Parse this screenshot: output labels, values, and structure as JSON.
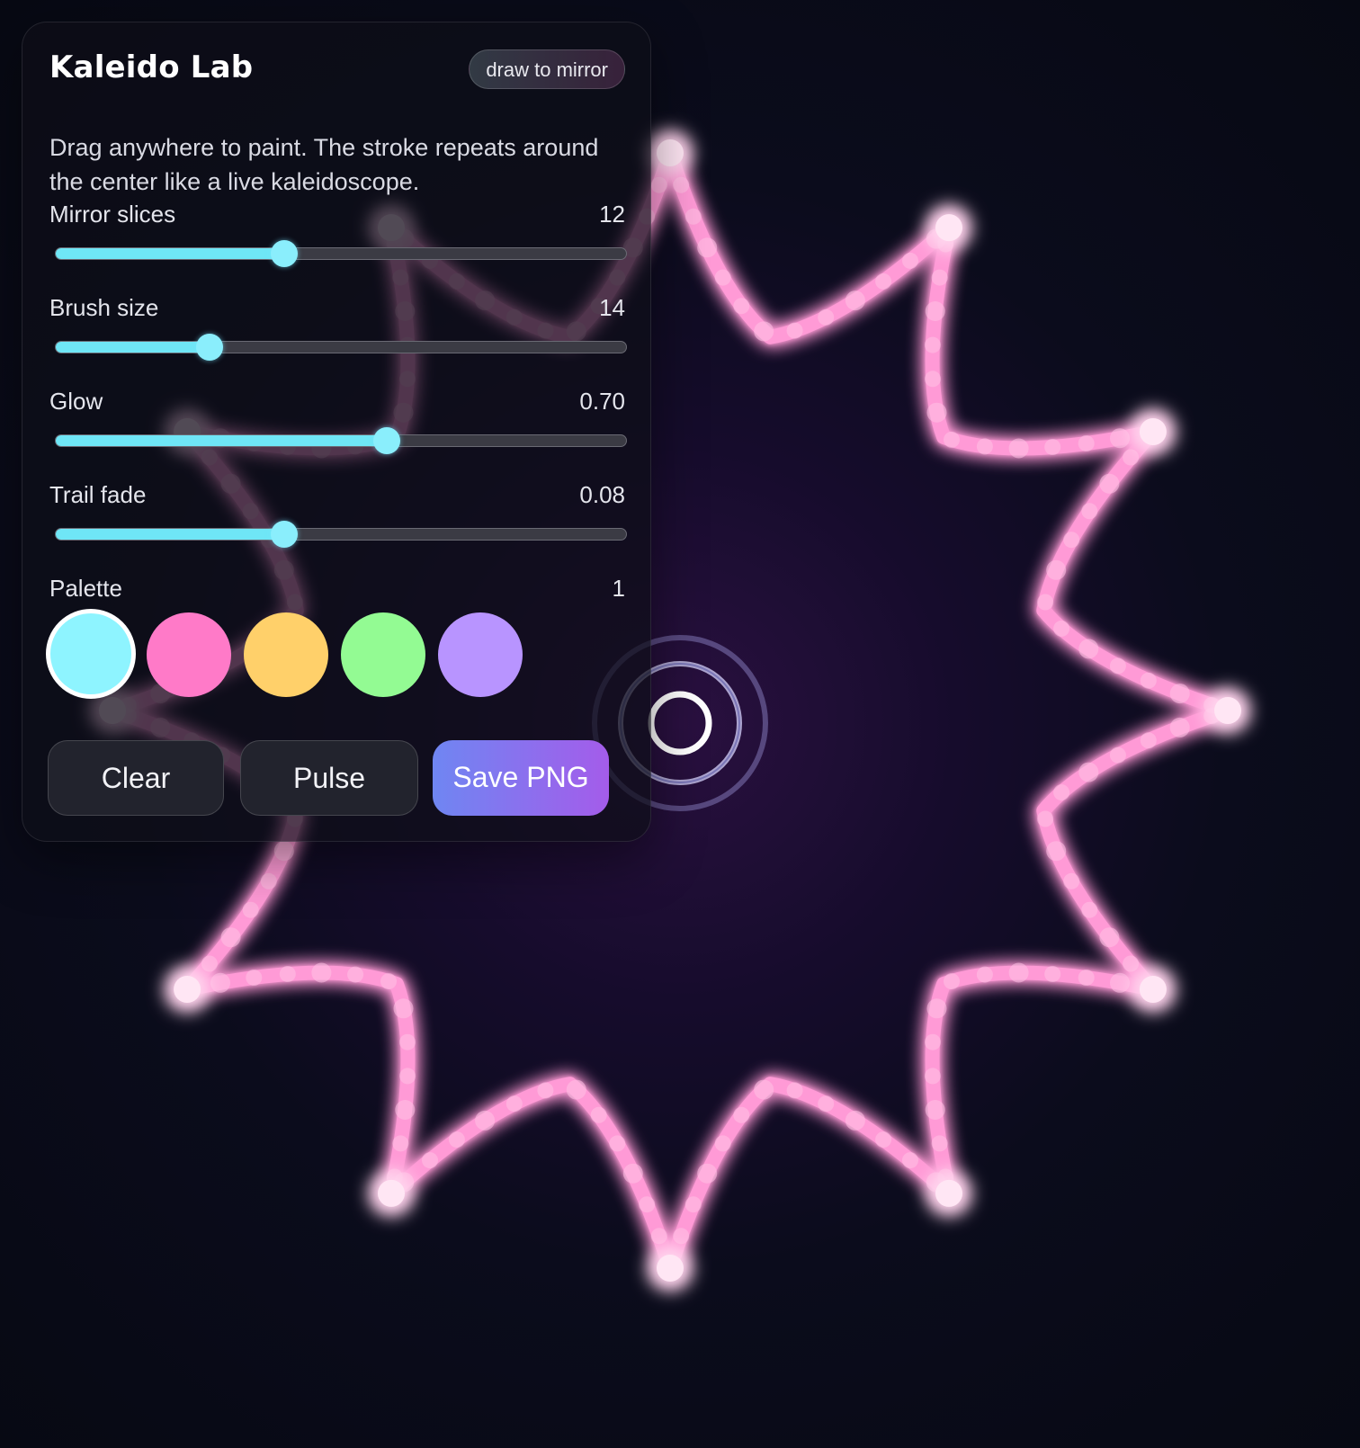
{
  "panel": {
    "title": "Kaleido Lab",
    "badge": "draw to mirror",
    "description": "Drag anywhere to paint. The stroke repeats around the center like a live kaleidoscope."
  },
  "controls": [
    {
      "label": "Mirror slices",
      "value": "12",
      "fraction": 0.4
    },
    {
      "label": "Brush size",
      "value": "14",
      "fraction": 0.27
    },
    {
      "label": "Glow",
      "value": "0.70",
      "fraction": 0.58
    },
    {
      "label": "Trail fade",
      "value": "0.08",
      "fraction": 0.4
    }
  ],
  "palette": {
    "label": "Palette",
    "value": "1",
    "selected_index": 0,
    "colors": [
      "#8ef4ff",
      "#ff7ac8",
      "#ffd06a",
      "#93fb93",
      "#b894ff"
    ]
  },
  "buttons": {
    "clear": "Clear",
    "pulse": "Pulse",
    "save": "Save PNG"
  },
  "artwork": {
    "stroke_color": "#ff9ad6",
    "core_color": "#ffe6f4",
    "slices": 12
  }
}
